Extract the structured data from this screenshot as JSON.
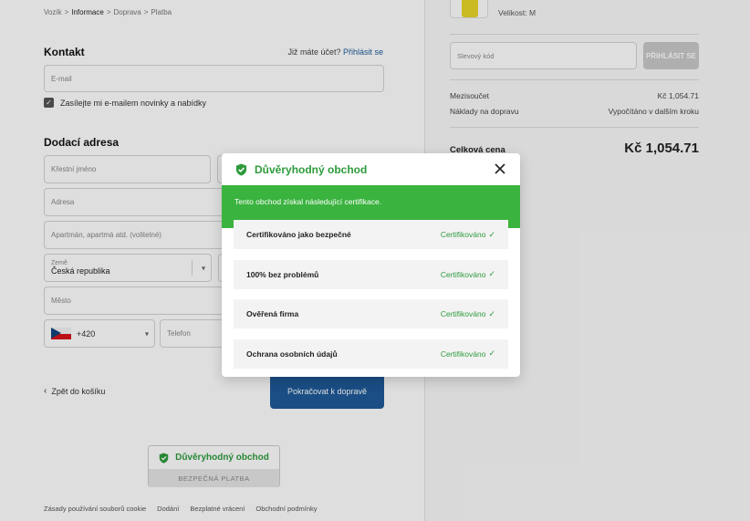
{
  "breadcrumb": {
    "items": [
      "Vozík",
      "Informace",
      "Doprava",
      "Platba"
    ],
    "separator": ">"
  },
  "contact": {
    "title": "Kontakt",
    "login_prompt": "Již máte účet?",
    "login_link": "Přihlásit se",
    "email_placeholder": "E-mail",
    "newsletter_label": "Zasílejte mi e-mailem novinky a nabídky",
    "newsletter_checked": true
  },
  "shipping": {
    "title": "Dodací adresa",
    "first_name_placeholder": "Křestní jméno",
    "address_placeholder": "Adresa",
    "apartment_placeholder": "Apartmán, apartmá atd. (volitelné)",
    "country_label": "Země",
    "country_value": "Česká republika",
    "city_placeholder": "Město",
    "phone_prefix": "+420",
    "phone_placeholder": "Telefon"
  },
  "actions": {
    "back_label": "Zpět do košíku",
    "continue_label": "Pokračovat k dopravě"
  },
  "trust_badge": {
    "title": "Důvěryhodný obchod",
    "subtitle": "BEZPEČNÁ PLATBA"
  },
  "footer": {
    "links": [
      "Zásady používání souborů cookie",
      "Dodání",
      "Bezplatné vrácení",
      "Obchodní podmínky"
    ]
  },
  "summary": {
    "product_size": "Velikost: M",
    "discount_placeholder": "Slevový kód",
    "discount_button": "PŘIHLÁSIT SE",
    "subtotal_label": "Mezisoučet",
    "subtotal_value": "Kč 1,054.71",
    "shipping_label": "Náklady na dopravu",
    "shipping_value": "Vypočítáno v dalším kroku",
    "total_label": "Celková cena",
    "total_value": "Kč 1,054.71"
  },
  "modal": {
    "title": "Důvěryhodný obchod",
    "banner_text": "Tento obchod získal následující certifikace.",
    "certifications": [
      {
        "name": "Certifikováno jako bezpečné",
        "status": "Certifikováno"
      },
      {
        "name": "100% bez problémů",
        "status": "Certifikováno"
      },
      {
        "name": "Ověřená firma",
        "status": "Certifikováno"
      },
      {
        "name": "Ochrana osobních údajů",
        "status": "Certifikováno"
      }
    ]
  },
  "colors": {
    "brand_blue": "#1e5a99",
    "trust_green": "#2e9b3d",
    "banner_green": "#3bb33f"
  }
}
